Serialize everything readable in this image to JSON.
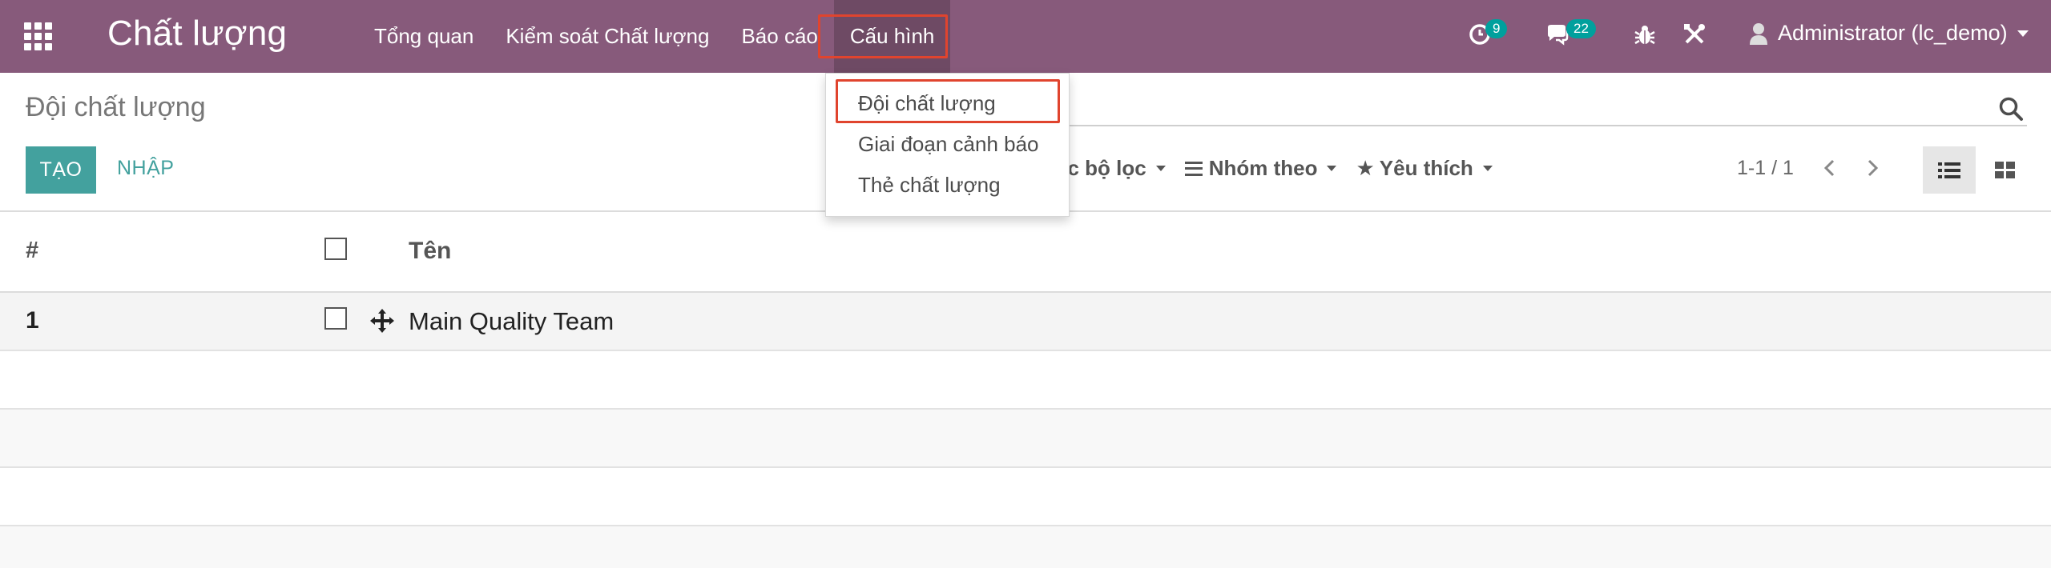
{
  "navbar": {
    "app_title": "Chất lượng",
    "menu": [
      {
        "label": "Tổng quan"
      },
      {
        "label": "Kiểm soát Chất lượng"
      },
      {
        "label": "Báo cáo"
      },
      {
        "label": "Cấu hình"
      }
    ],
    "activity_count": "9",
    "messages_count": "22",
    "user_name": "Administrator (lc_demo)"
  },
  "dropdown": {
    "items": [
      {
        "label": "Đội chất lượng"
      },
      {
        "label": "Giai đoạn cảnh báo"
      },
      {
        "label": "Thẻ chất lượng"
      }
    ]
  },
  "control_panel": {
    "breadcrumb": "Đội chất lượng",
    "search_placeholder": "...",
    "create_label": "TẠO",
    "import_label": "NHẬP",
    "filters_label": "ác bộ lọc",
    "groupby_label": "Nhóm theo",
    "favorites_label": "Yêu thích",
    "pager": "1-1 / 1"
  },
  "table": {
    "headers": {
      "num": "#",
      "name": "Tên"
    },
    "rows": [
      {
        "num": "1",
        "name": "Main Quality Team"
      }
    ]
  },
  "colors": {
    "navbar": "#875a7b",
    "primary": "#43a19e",
    "badge": "#00a09d",
    "highlight": "#e0442e"
  }
}
